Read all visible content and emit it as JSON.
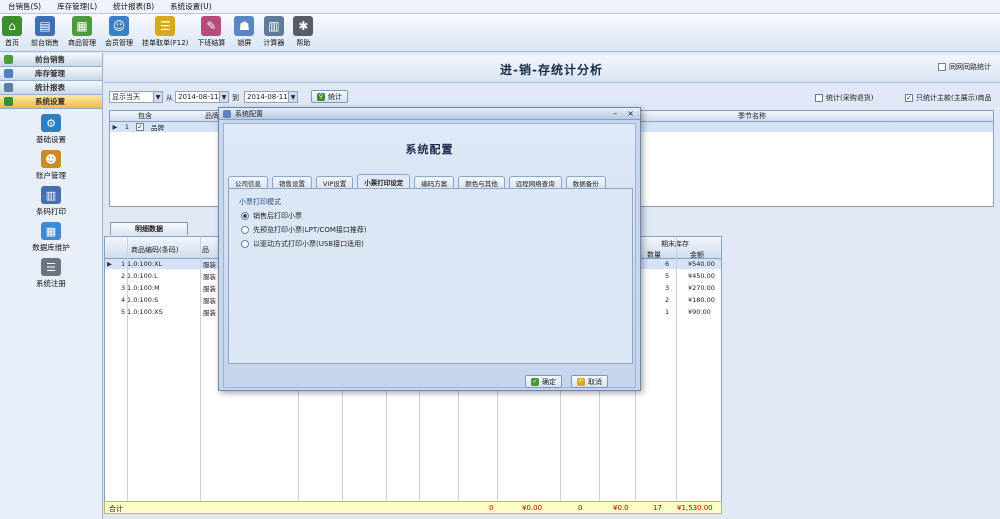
{
  "menu": [
    "台销售(S)",
    "库存管理(L)",
    "统计报表(B)",
    "系统设置(U)"
  ],
  "toolbar": [
    {
      "label": "首页",
      "icon": "home-icon",
      "color": "#3b8e2c",
      "glyph": "⌂"
    },
    {
      "label": "前台销售",
      "icon": "cashier-icon",
      "color": "#3f6fb5",
      "glyph": "▤"
    },
    {
      "label": "商品管理",
      "icon": "goods-icon",
      "color": "#4d9a3a",
      "glyph": "▦"
    },
    {
      "label": "会员管理",
      "icon": "member-icon",
      "color": "#3c7fc8",
      "glyph": "☺"
    },
    {
      "label": "挂单取单(F12)",
      "icon": "pending-order-icon",
      "color": "#d9a81e",
      "glyph": "☰"
    },
    {
      "label": "下班结算",
      "icon": "settlement-icon",
      "color": "#b84a7c",
      "glyph": "✎"
    },
    {
      "label": "锁屏",
      "icon": "lock-screen-icon",
      "color": "#5a86c3",
      "glyph": "☗"
    },
    {
      "label": "计算器",
      "icon": "calculator-icon",
      "color": "#607a99",
      "glyph": "▥"
    },
    {
      "label": "帮助",
      "icon": "help-icon",
      "color": "#555c66",
      "glyph": "✱"
    }
  ],
  "nav": {
    "sections": [
      "前台销售",
      "库存管理",
      "统计报表",
      "系统设置"
    ],
    "subitems": [
      {
        "label": "基础设置",
        "icon": "basic-settings-icon",
        "color": "#2f7fc1",
        "glyph": "⚙"
      },
      {
        "label": "账户管理",
        "icon": "account-icon",
        "color": "#c98a2a",
        "glyph": "☻"
      },
      {
        "label": "条码打印",
        "icon": "barcode-print-icon",
        "color": "#4570b0",
        "glyph": "▥"
      },
      {
        "label": "数据库维护",
        "icon": "database-icon",
        "color": "#3f8ad0",
        "glyph": "▦"
      },
      {
        "label": "系统注册",
        "icon": "registration-icon",
        "color": "#6b7481",
        "glyph": "☰"
      }
    ]
  },
  "page": {
    "title": "进-销-存统计分析",
    "same_row_label": "同网同路统计"
  },
  "filter": {
    "range": "显示当天",
    "from_label": "从",
    "from_date": "2014-08-11",
    "to_label": "到",
    "to_date": "2014-08-11",
    "stat_button": "统计",
    "chk_purchase": "统计(采购退货)",
    "chk_display": "只统计主款(主展示)商品"
  },
  "top_grid": {
    "headers": [
      "包含",
      "品牌",
      "季节名称"
    ],
    "row": {
      "num": "1",
      "value": "品牌"
    }
  },
  "detail": {
    "tab": "明细数据",
    "col_code": "商品编码(条码)",
    "col_name": "品",
    "col_end_group": "期末库存",
    "col_qty": "数量",
    "col_amount": "金额",
    "rows": [
      {
        "num": "1",
        "code": "1.0:100:XL",
        "name": "服装",
        "qty": "6",
        "amount": "¥540.00"
      },
      {
        "num": "2",
        "code": "1.0:100:L",
        "name": "服装",
        "qty": "5",
        "amount": "¥450.00"
      },
      {
        "num": "3",
        "code": "1.0:100:M",
        "name": "服装",
        "qty": "3",
        "amount": "¥270.00"
      },
      {
        "num": "4",
        "code": "1.0:100:S",
        "name": "服装",
        "qty": "2",
        "amount": "¥180.00"
      },
      {
        "num": "5",
        "code": "1.0:100:XS",
        "name": "服装",
        "qty": "1",
        "amount": "¥90.00"
      }
    ],
    "total_label": "合计",
    "totals": {
      "t1": "0",
      "t2": "¥0.00",
      "t3": "0",
      "t4": "¥0.0",
      "qty": "17",
      "amount": "¥1,530.00"
    }
  },
  "dialog": {
    "window_title": "系统配置",
    "heading": "系统配置",
    "tabs": [
      "公司信息",
      "销售设置",
      "VIP设置",
      "小票打印设定",
      "编码方案",
      "颜色与其他",
      "远程网络查询",
      "数据备份"
    ],
    "active_tab": 3,
    "group_label": "小票打印模式",
    "options": [
      "销售后打印小票",
      "先预览打印小票(LPT/COM接口推荐)",
      "以驱动方式打印小票(USB接口适用)"
    ],
    "selected_option": 0,
    "ok_label": "确定",
    "cancel_label": "取消"
  }
}
